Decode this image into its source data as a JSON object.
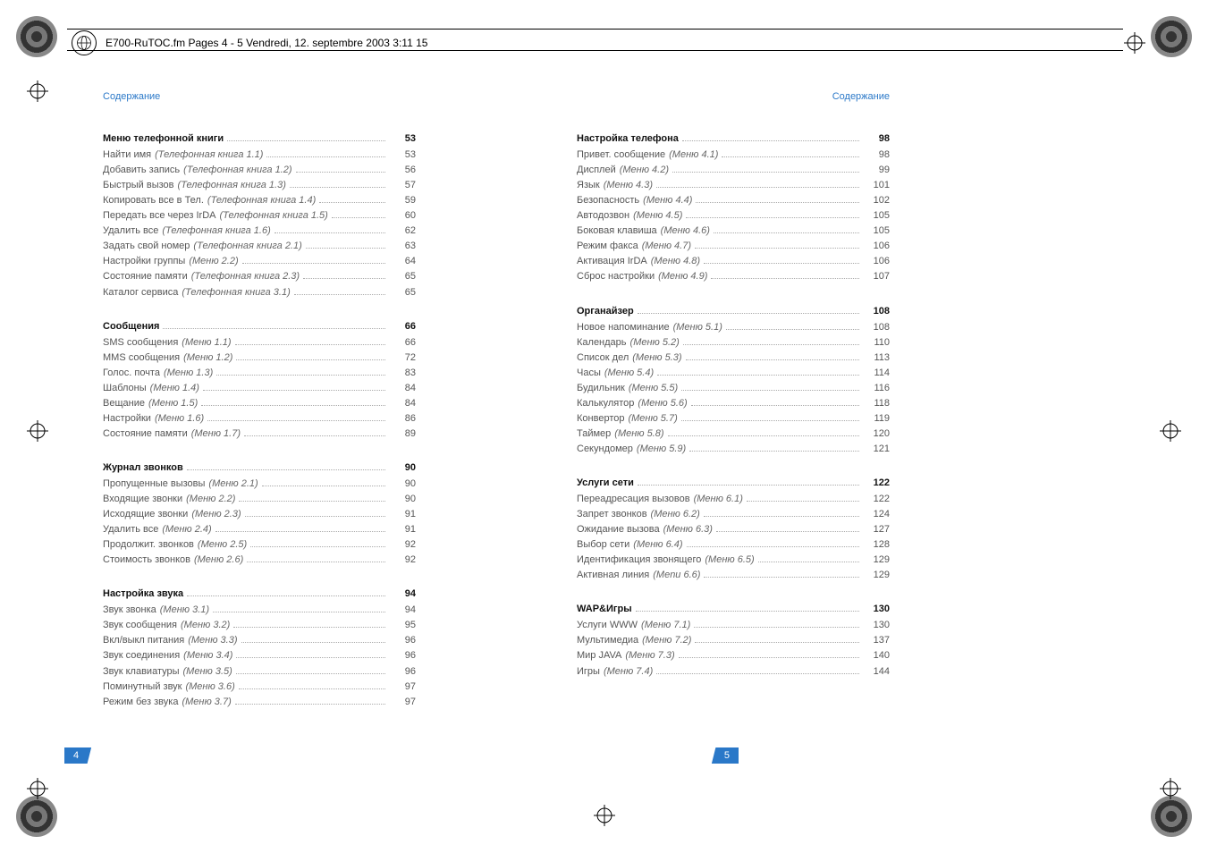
{
  "file_header": "E700-RuTOC.fm  Pages 4 - 5  Vendredi, 12. septembre 2003  3:11 15",
  "running_head": "Содержание",
  "left_page_number": "4",
  "right_page_number": "5",
  "left_sections": [
    {
      "title": "Меню телефонной книги",
      "page": "53",
      "entries": [
        {
          "label": "Найти имя",
          "menu": "(Телефонная книга 1.1)",
          "page": "53"
        },
        {
          "label": "Добавить запись",
          "menu": "(Телефонная книга 1.2)",
          "page": "56"
        },
        {
          "label": "Быстрый вызов",
          "menu": "(Телефонная книга 1.3)",
          "page": "57"
        },
        {
          "label": "Копировать все в Тел.",
          "menu": "(Телефонная книга 1.4)",
          "page": "59"
        },
        {
          "label": "Передать все через IrDA",
          "menu": "(Телефонная книга 1.5)",
          "page": "60"
        },
        {
          "label": "Удалить все",
          "menu": "(Телефонная книга 1.6)",
          "page": "62"
        },
        {
          "label": "Задать свой номер",
          "menu": "(Телефонная книга 2.1)",
          "page": "63"
        },
        {
          "label": "Настройки группы",
          "menu": "(Меню 2.2)",
          "page": "64"
        },
        {
          "label": "Состояние памяти",
          "menu": "(Телефонная книга 2.3)",
          "page": "65"
        },
        {
          "label": "Каталог сервиса",
          "menu": "(Телефонная книга 3.1)",
          "page": "65"
        }
      ]
    },
    {
      "title": "Сообщения",
      "page": "66",
      "entries": [
        {
          "label": "SMS сообщения",
          "menu": "(Меню 1.1)",
          "page": "66"
        },
        {
          "label": "MMS сообщения",
          "menu": "(Меню 1.2)",
          "page": "72"
        },
        {
          "label": "Голос. почта",
          "menu": "(Меню 1.3)",
          "page": "83"
        },
        {
          "label": "Шаблоны",
          "menu": "(Меню 1.4)",
          "page": "84"
        },
        {
          "label": "Вещание",
          "menu": "(Меню 1.5)",
          "page": "84"
        },
        {
          "label": "Настройки",
          "menu": "(Меню 1.6)",
          "page": "86"
        },
        {
          "label": "Состояние памяти",
          "menu": "(Меню 1.7)",
          "page": "89"
        }
      ]
    },
    {
      "title": "Журнал звонков",
      "page": "90",
      "entries": [
        {
          "label": "Пропущенные вызовы",
          "menu": "(Меню 2.1)",
          "page": "90"
        },
        {
          "label": "Входящие звонки",
          "menu": "(Меню 2.2)",
          "page": "90"
        },
        {
          "label": "Исходящие звонки",
          "menu": "(Меню 2.3)",
          "page": "91"
        },
        {
          "label": "Удалить все",
          "menu": "(Меню 2.4)",
          "page": "91"
        },
        {
          "label": "Продолжит. звонков",
          "menu": "(Меню 2.5)",
          "page": "92"
        },
        {
          "label": "Стоимость звонков",
          "menu": "(Меню 2.6)",
          "page": "92"
        }
      ]
    },
    {
      "title": "Настройка звука",
      "page": "94",
      "entries": [
        {
          "label": "Звук звонка",
          "menu": "(Меню 3.1)",
          "page": "94"
        },
        {
          "label": "Звук сообщения",
          "menu": "(Меню 3.2)",
          "page": "95"
        },
        {
          "label": "Вкл/выкл питания",
          "menu": "(Меню 3.3)",
          "page": "96"
        },
        {
          "label": "Звук соединения",
          "menu": "(Меню 3.4)",
          "page": "96"
        },
        {
          "label": "Звук клавиатуры",
          "menu": "(Меню 3.5)",
          "page": "96"
        },
        {
          "label": "Поминутный звук",
          "menu": "(Меню 3.6)",
          "page": "97"
        },
        {
          "label": "Режим без звука",
          "menu": "(Меню 3.7)",
          "page": "97"
        }
      ]
    }
  ],
  "right_sections": [
    {
      "title": "Настройка телефона",
      "page": "98",
      "entries": [
        {
          "label": "Привет. сообщение",
          "menu": "(Меню 4.1)",
          "page": "98"
        },
        {
          "label": "Дисплей",
          "menu": "(Меню 4.2)",
          "page": "99"
        },
        {
          "label": "Язык",
          "menu": "(Меню 4.3)",
          "page": "101"
        },
        {
          "label": "Безопасность",
          "menu": "(Меню 4.4)",
          "page": "102"
        },
        {
          "label": "Автодозвон",
          "menu": "(Меню 4.5)",
          "page": "105"
        },
        {
          "label": "Боковая клавиша",
          "menu": "(Меню 4.6)",
          "page": "105"
        },
        {
          "label": "Режим факса",
          "menu": "(Меню 4.7)",
          "page": "106"
        },
        {
          "label": "Активация IrDA",
          "menu": "(Меню 4.8)",
          "page": "106"
        },
        {
          "label": "Сброс настройки",
          "menu": "(Меню 4.9)",
          "page": "107"
        }
      ]
    },
    {
      "title": "Органайзер",
      "page": "108",
      "entries": [
        {
          "label": "Новое напоминание",
          "menu": "(Меню 5.1)",
          "page": "108"
        },
        {
          "label": "Календарь",
          "menu": "(Меню 5.2)",
          "page": "110"
        },
        {
          "label": "Список дел",
          "menu": "(Меню 5.3)",
          "page": "113"
        },
        {
          "label": "Часы",
          "menu": "(Меню 5.4)",
          "page": "114"
        },
        {
          "label": "Будильник",
          "menu": "(Меню 5.5)",
          "page": "116"
        },
        {
          "label": "Калькулятор",
          "menu": "(Меню 5.6)",
          "page": "118"
        },
        {
          "label": "Конвертор",
          "menu": "(Меню 5.7)",
          "page": "119"
        },
        {
          "label": "Таймер",
          "menu": "(Меню 5.8)",
          "page": "120"
        },
        {
          "label": "Секундомер",
          "menu": "(Меню 5.9)",
          "page": "121"
        }
      ]
    },
    {
      "title": "Услуги сети",
      "page": "122",
      "entries": [
        {
          "label": "Переадресация вызовов",
          "menu": "(Меню 6.1)",
          "page": "122"
        },
        {
          "label": "Запрет звонков",
          "menu": "(Меню 6.2)",
          "page": "124"
        },
        {
          "label": "Ожидание вызова",
          "menu": "(Меню 6.3)",
          "page": "127"
        },
        {
          "label": "Выбор сети",
          "menu": "(Меню 6.4)",
          "page": "128"
        },
        {
          "label": "Идентификация звонящего",
          "menu": "(Меню 6.5)",
          "page": "129"
        },
        {
          "label": "Активная линия",
          "menu": "(Menu 6.6)",
          "page": "129"
        }
      ]
    },
    {
      "title": "WAP&Игры",
      "page": "130",
      "entries": [
        {
          "label": "Услуги WWW",
          "menu": "(Меню 7.1)",
          "page": "130"
        },
        {
          "label": "Мультимедиа",
          "menu": "(Меню 7.2)",
          "page": "137"
        },
        {
          "label": "Мир JAVA",
          "menu": "(Меню 7.3)",
          "page": "140"
        },
        {
          "label": "Игры",
          "menu": "(Меню 7.4)",
          "page": "144"
        }
      ]
    }
  ]
}
